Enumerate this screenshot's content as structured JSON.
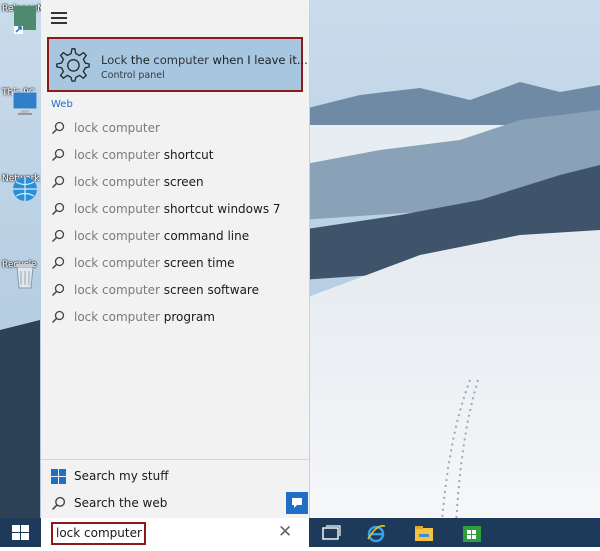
{
  "desktop": {
    "icons": [
      {
        "label": "ReleaseN",
        "icon": "shortcut-file-icon"
      },
      {
        "label": "This PC",
        "icon": "monitor-icon"
      },
      {
        "label": "Network",
        "icon": "network-globe-icon"
      },
      {
        "label": "Recycle",
        "icon": "recycle-bin-icon"
      }
    ]
  },
  "start": {
    "menu_icon": "hamburger-icon",
    "best_match": {
      "title_query": "Lock",
      "title_mid_plain": " the ",
      "title_query2": "computer",
      "title_rest": " when I leave it...",
      "subtitle": "Control panel",
      "icon": "gear-icon"
    },
    "web_section_label": "Web",
    "web_query": "lock computer",
    "web_suggestions": [
      {
        "query": "lock computer",
        "rest": ""
      },
      {
        "query": "lock computer",
        "rest": " shortcut"
      },
      {
        "query": "lock computer",
        "rest": " screen"
      },
      {
        "query": "lock computer",
        "rest": " shortcut windows 7"
      },
      {
        "query": "lock computer",
        "rest": " command line"
      },
      {
        "query": "lock computer",
        "rest": " screen time"
      },
      {
        "query": "lock computer",
        "rest": " screen software"
      },
      {
        "query": "lock computer",
        "rest": " program"
      }
    ],
    "search_my_stuff": "Search my stuff",
    "search_the_web": "Search the web"
  },
  "taskbar": {
    "search_value": "lock computer",
    "clear_glyph": "✕",
    "items": [
      "task-view-icon",
      "internet-explorer-icon",
      "file-explorer-icon",
      "store-icon"
    ]
  },
  "colors": {
    "highlight": "#a7c6e0",
    "focus_border": "#8b1a1a",
    "accent": "#1f6fc5",
    "taskbar": "#1e3a5a"
  }
}
